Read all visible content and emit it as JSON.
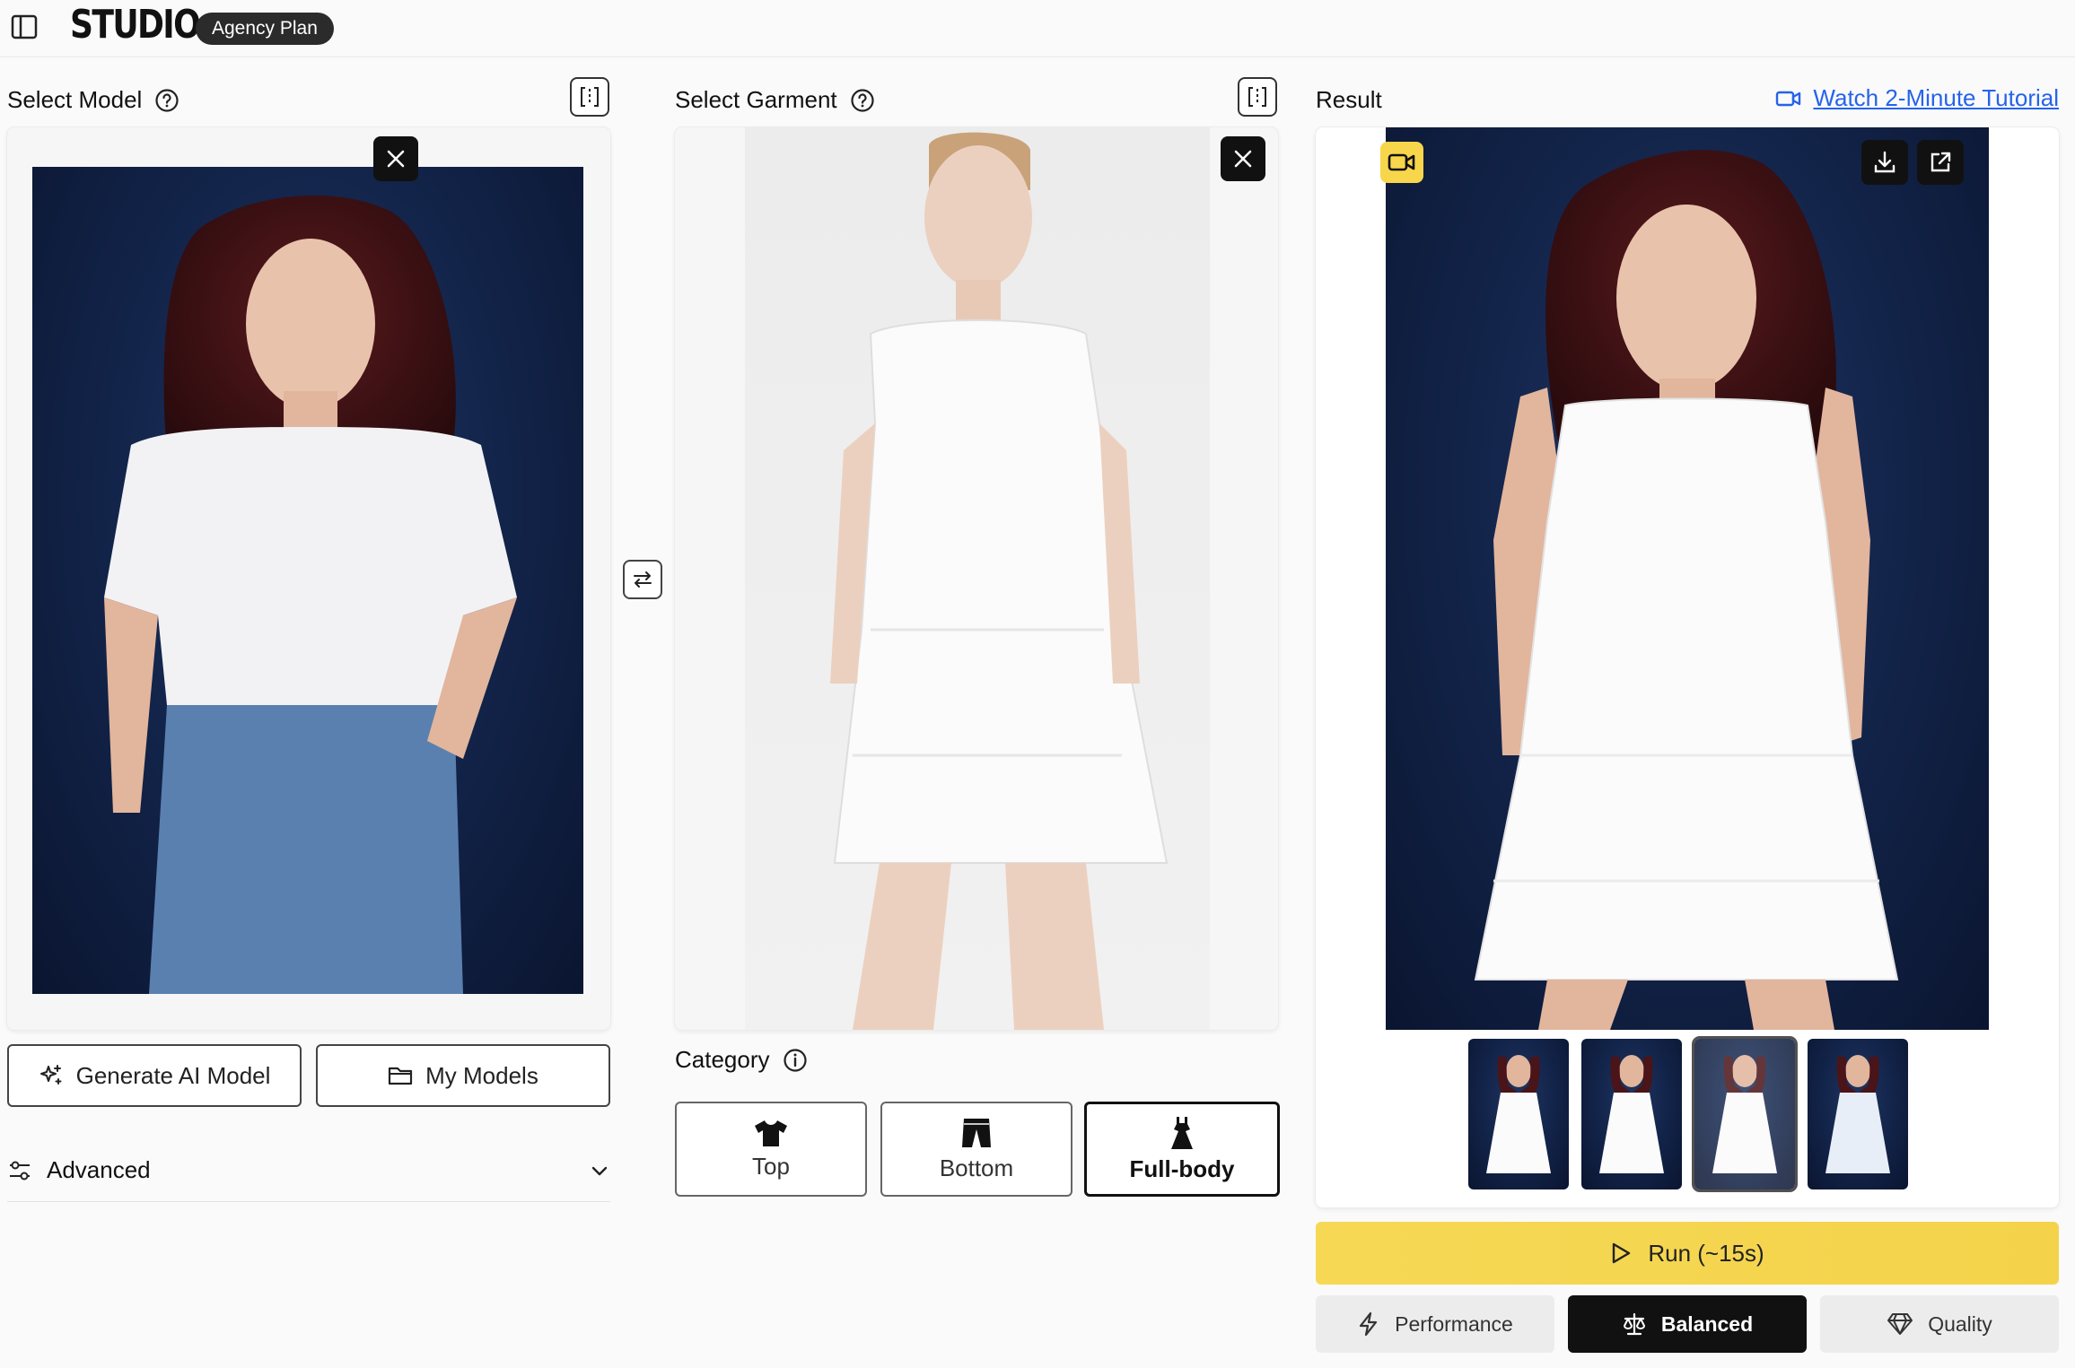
{
  "header": {
    "logo": "STUDIO",
    "plan_badge": "Agency Plan"
  },
  "model_panel": {
    "title": "Select Model",
    "generate_label": "Generate AI Model",
    "my_models_label": "My Models",
    "advanced_label": "Advanced"
  },
  "garment_panel": {
    "title": "Select Garment",
    "category_label": "Category",
    "categories": [
      {
        "label": "Top",
        "icon": "tshirt-icon",
        "selected": false
      },
      {
        "label": "Bottom",
        "icon": "pants-icon",
        "selected": false
      },
      {
        "label": "Full-body",
        "icon": "dress-icon",
        "selected": true
      }
    ]
  },
  "result_panel": {
    "title": "Result",
    "tutorial_link": "Watch 2-Minute Tutorial",
    "run_label": "Run (~15s)",
    "modes": [
      {
        "label": "Performance",
        "icon": "lightning-icon",
        "selected": false
      },
      {
        "label": "Balanced",
        "icon": "scale-icon",
        "selected": true
      },
      {
        "label": "Quality",
        "icon": "diamond-icon",
        "selected": false
      }
    ],
    "thumbnails_count": 4,
    "selected_thumbnail": 3
  },
  "colors": {
    "accent_yellow": "#f6d855",
    "link_blue": "#2563eb",
    "dark": "#111111",
    "photo_bg": "#13244a"
  }
}
